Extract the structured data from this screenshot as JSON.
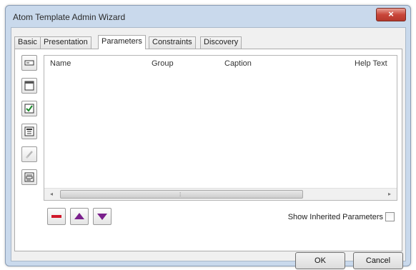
{
  "window": {
    "title": "Atom Template Admin Wizard",
    "close_label": "×"
  },
  "tabs": [
    {
      "label": "Basic",
      "active": false
    },
    {
      "label": "Presentation",
      "active": false
    },
    {
      "label": "Parameters",
      "active": true
    },
    {
      "label": "Constraints",
      "active": false
    },
    {
      "label": "Discovery",
      "active": false
    }
  ],
  "side_tools": [
    {
      "icon": "textbox-icon"
    },
    {
      "icon": "window-icon"
    },
    {
      "icon": "checkbox-icon"
    },
    {
      "icon": "listbox-icon"
    },
    {
      "icon": "pen-icon",
      "disabled": true
    },
    {
      "icon": "form-icon"
    }
  ],
  "grid": {
    "columns": [
      "Name",
      "Group",
      "Caption",
      "Help Text"
    ],
    "rows": []
  },
  "actions": {
    "remove_icon": "minus-icon",
    "move_up_icon": "arrow-up-icon",
    "move_down_icon": "arrow-down-icon"
  },
  "show_inherited": {
    "label": "Show Inherited Parameters",
    "checked": false
  },
  "footer": {
    "ok_label": "OK",
    "cancel_label": "Cancel"
  },
  "colors": {
    "accent_red": "#d0182a",
    "accent_purple": "#7a1f8c",
    "title_bar": "#c9d9ec"
  }
}
